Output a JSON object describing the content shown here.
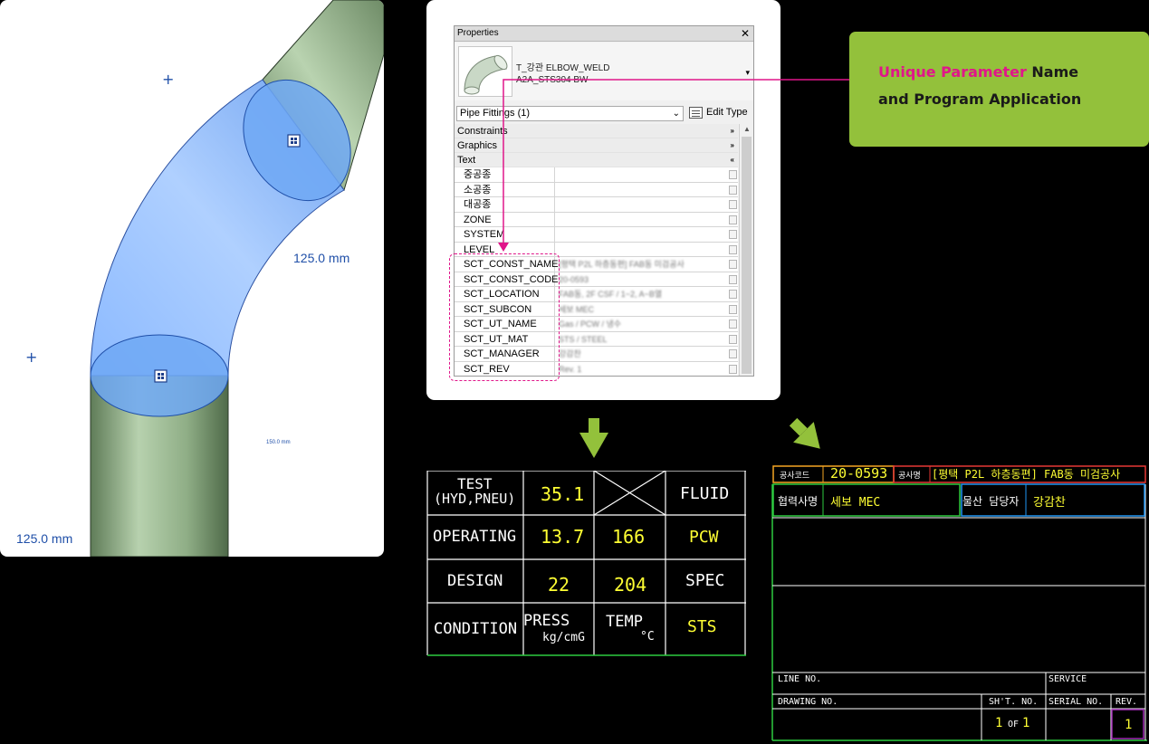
{
  "view3d": {
    "dims": {
      "right": "125.0 mm",
      "bottom_left": "125.0 mm",
      "small": "150.0 mm"
    },
    "plus": "+",
    "colors": {
      "pipe": "#a8c7a0",
      "selection": "#5a9bef",
      "outline": "#1f4fa8"
    }
  },
  "properties": {
    "title": "Properties",
    "close": "✕",
    "type_name": "T_강관 ELBOW_WELD",
    "type_sub": "A2A_STS304 BW",
    "type_dropdown": "▾",
    "filter": "Pipe Fittings (1)",
    "filter_arrow": "⌄",
    "edit_type": "Edit Type",
    "groups": [
      {
        "label": "Constraints",
        "chevron": "»"
      },
      {
        "label": "Graphics",
        "chevron": "»"
      },
      {
        "label": "Text",
        "chevron": "«"
      }
    ],
    "rows": [
      {
        "key": "중공종",
        "value": ""
      },
      {
        "key": "소공종",
        "value": ""
      },
      {
        "key": "대공종",
        "value": ""
      },
      {
        "key": "ZONE",
        "value": ""
      },
      {
        "key": "SYSTEM",
        "value": ""
      },
      {
        "key": "LEVEL",
        "value": ""
      },
      {
        "key": "SCT_CONST_NAME",
        "value": "[평택 P2L 하층동편] FAB동 미검공사"
      },
      {
        "key": "SCT_CONST_CODE",
        "value": "20-0593"
      },
      {
        "key": "SCT_LOCATION",
        "value": "FAB동, 2F CSF / 1~2, A~B열"
      },
      {
        "key": "SCT_SUBCON",
        "value": "세보 MEC"
      },
      {
        "key": "SCT_UT_NAME",
        "value": "Gas / PCW / 냉수"
      },
      {
        "key": "SCT_UT_MAT",
        "value": "STS / STEEL"
      },
      {
        "key": "SCT_MANAGER",
        "value": "강감찬"
      },
      {
        "key": "SCT_REV",
        "value": "Rev. 1"
      }
    ]
  },
  "callout": {
    "highlight": "Unique Parameter",
    "rest": " Name",
    "line2": "and Program Application",
    "colors": {
      "bg": "#93c13b",
      "accent": "#e0168a"
    }
  },
  "cad_table": {
    "test_l1": "TEST",
    "test_l2": "(HYD,PNEU)",
    "test_val": "35.1",
    "fluid": "FLUID",
    "operating": "OPERATING",
    "op_press": "13.7",
    "op_temp": "166",
    "fluid_val": "PCW",
    "design": "DESIGN",
    "des_press": "22",
    "des_temp": "204",
    "spec": "SPEC",
    "condition": "CONDITION",
    "press": "PRESS",
    "press_unit": "kg/cmG",
    "temp": "TEMP",
    "temp_unit": "°C",
    "spec_val": "STS"
  },
  "title_block": {
    "code_label": "공사코드",
    "code_value": "20-0593",
    "name_label": "공사명",
    "name_value": "[평택 P2L 하층동편] FAB동 미검공사",
    "subcon_label": "협력사명",
    "subcon_value": "세보 MEC",
    "manager_label": "물산 담당자",
    "manager_value": "강감찬",
    "line_no": "LINE NO.",
    "service": "SERVICE",
    "drawing_no": "DRAWING NO.",
    "sht_no": "SH'T. NO.",
    "serial_no": "SERIAL NO.",
    "rev": "REV.",
    "sheet_of": "OF",
    "sheet_cur": "1",
    "sheet_total": "1",
    "rev_value": "1"
  }
}
